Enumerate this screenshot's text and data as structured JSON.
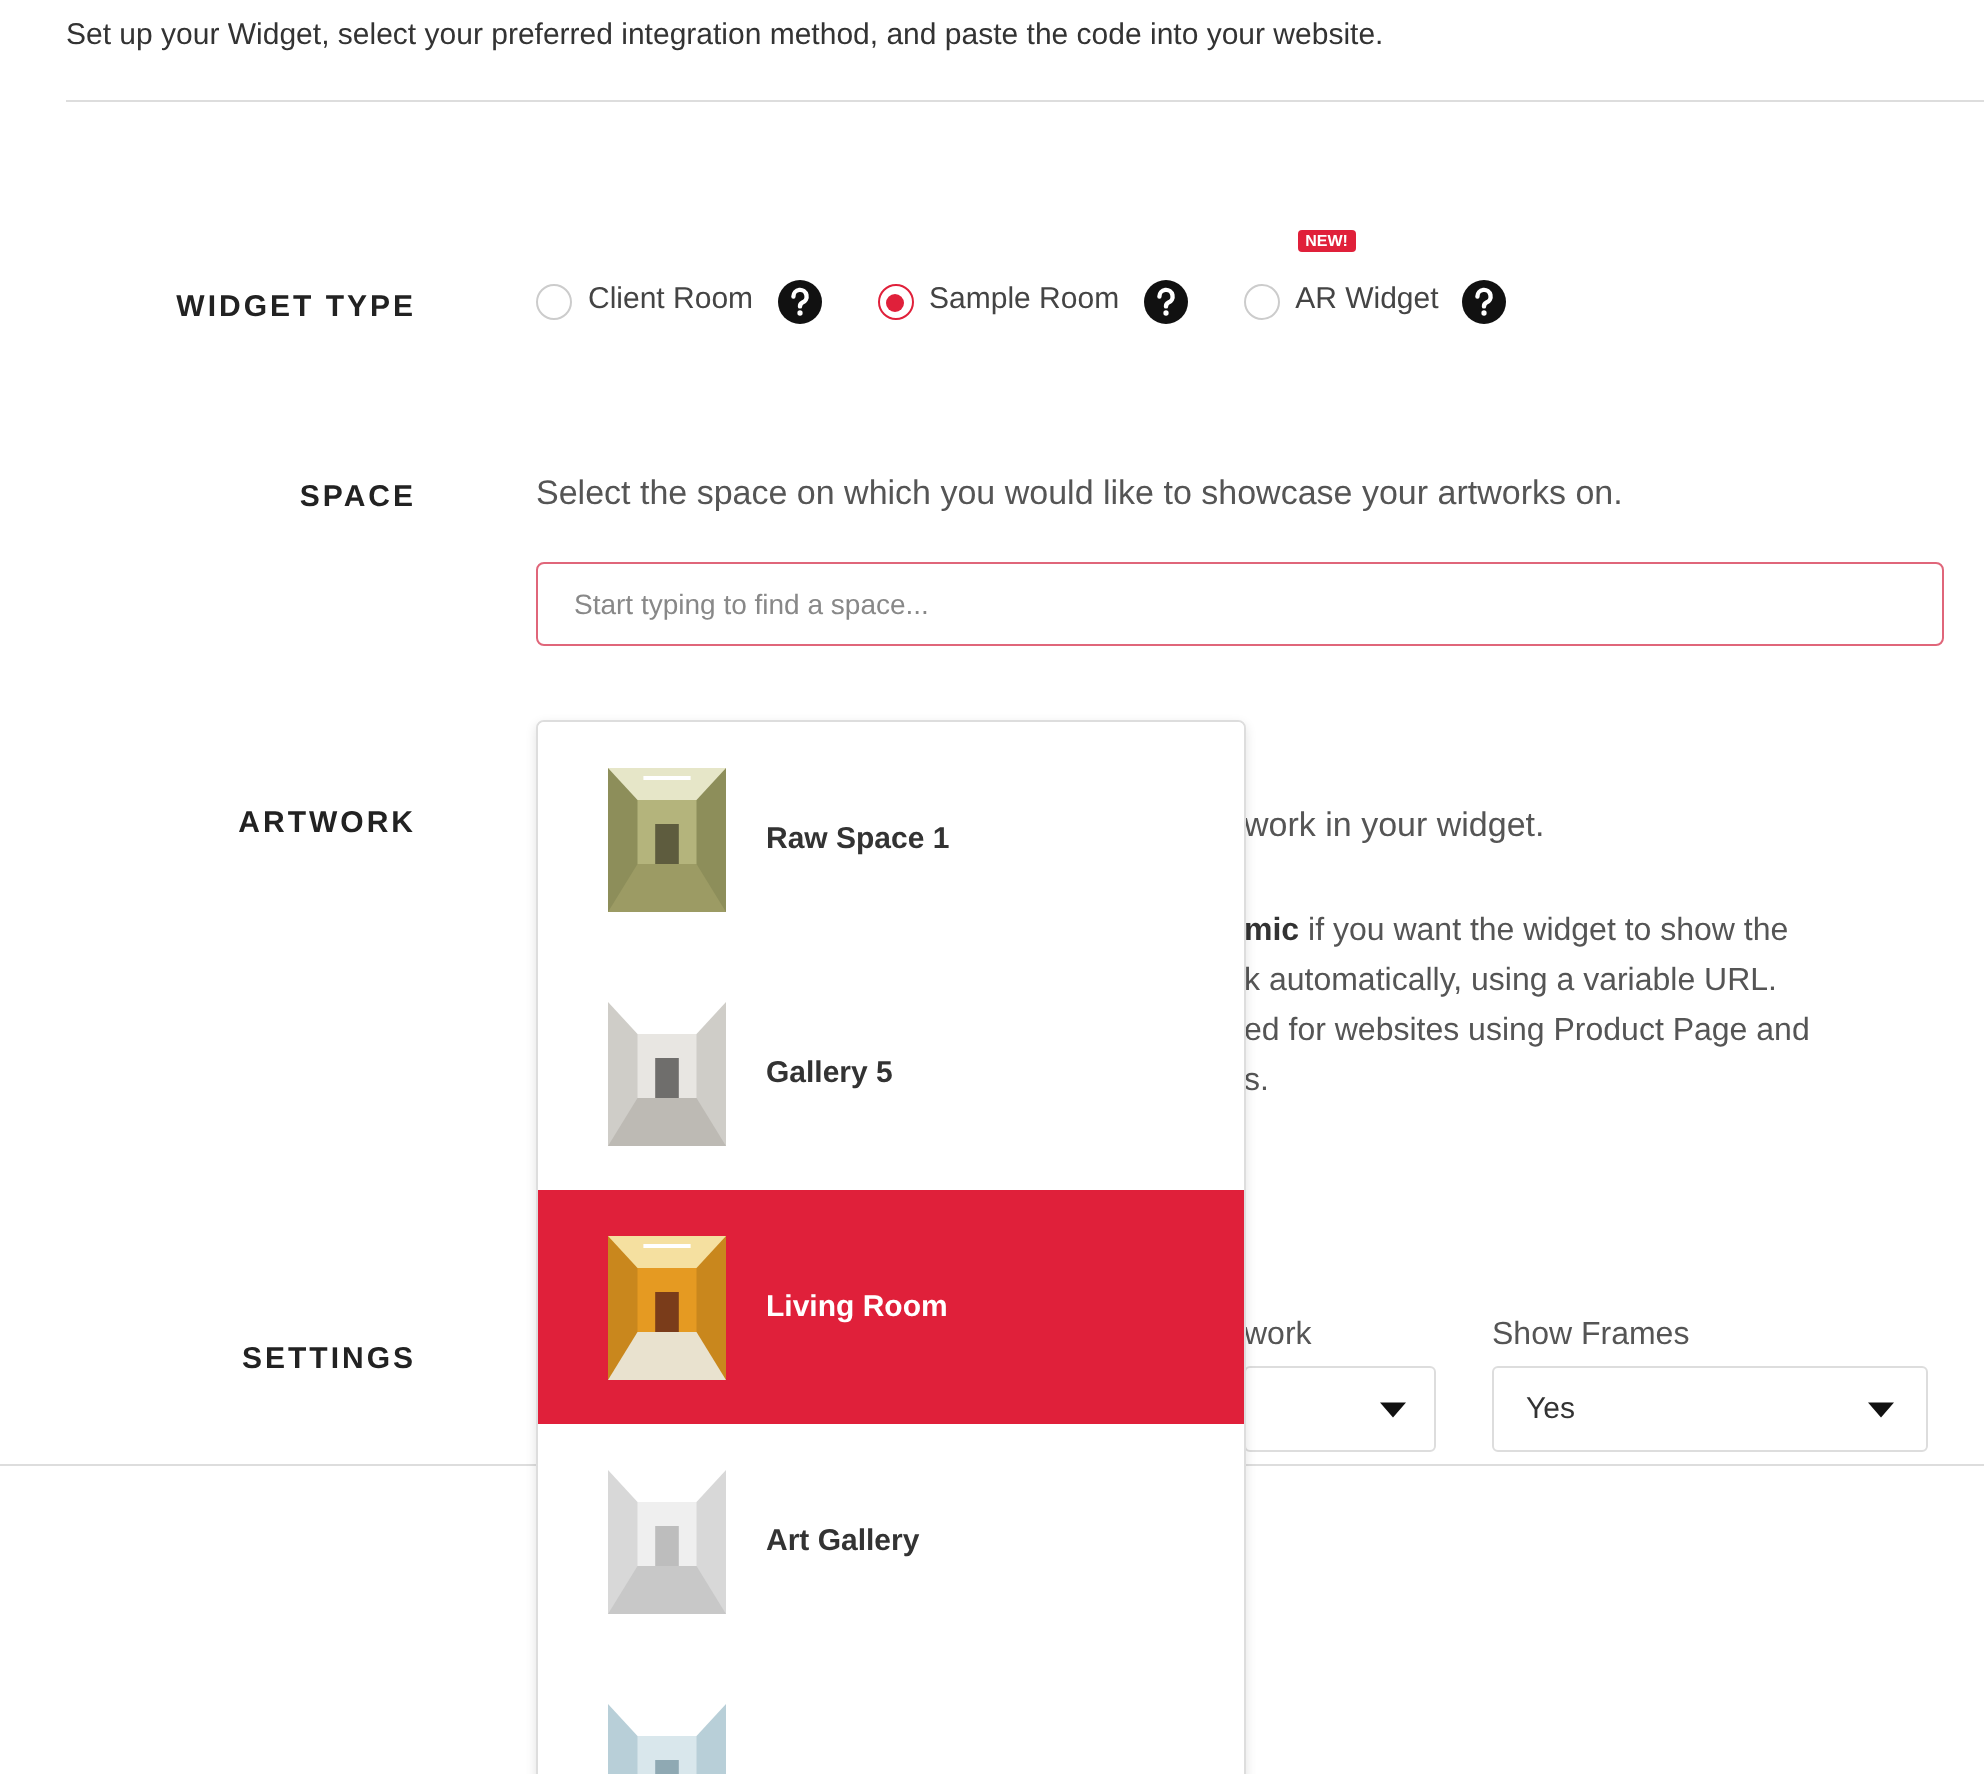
{
  "intro": "Set up your Widget, select your preferred integration method, and paste the code into your website.",
  "widget_type": {
    "label": "WIDGET TYPE",
    "options": [
      {
        "label": "Client Room",
        "selected": false
      },
      {
        "label": "Sample Room",
        "selected": true
      },
      {
        "label": "AR Widget",
        "selected": false,
        "badge": "NEW!"
      }
    ]
  },
  "space": {
    "label": "SPACE",
    "description": "Select the space on which you would like to showcase your artworks on.",
    "search": {
      "placeholder": "Start typing to find a space..."
    },
    "dropdown": [
      {
        "label": "Raw Space 1",
        "selected": false
      },
      {
        "label": "Gallery 5",
        "selected": false
      },
      {
        "label": "Living Room",
        "selected": true
      },
      {
        "label": "Art Gallery",
        "selected": false
      },
      {
        "selected": false
      }
    ]
  },
  "artwork": {
    "label": "ARTWORK",
    "description": "work in your widget.",
    "note_lines": [
      "**mic** if you want the widget to show the",
      "k automatically, using a variable URL.",
      "ed for websites using Product Page and",
      "s."
    ]
  },
  "settings": {
    "label": "SETTINGS",
    "fields": [
      {
        "label": "work"
      },
      {
        "label": "Show Frames",
        "value": "Yes"
      }
    ]
  }
}
